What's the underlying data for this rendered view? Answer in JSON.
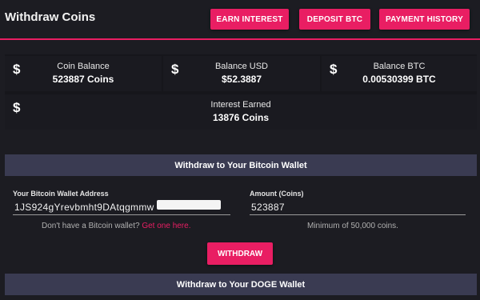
{
  "header": {
    "title": "Withdraw Coins",
    "buttons": {
      "earn_interest": "EARN INTEREST",
      "deposit_btc": "DEPOSIT BTC",
      "payment_history": "PAYMENT HISTORY"
    }
  },
  "stats": [
    {
      "icon": "dollar-icon",
      "symbol": "$",
      "label": "Coin Balance",
      "value": "523887 Coins"
    },
    {
      "icon": "dollar-icon",
      "symbol": "$",
      "label": "Balance USD",
      "value": "$52.3887"
    },
    {
      "icon": "dollar-icon",
      "symbol": "$",
      "label": "Balance BTC",
      "value": "0.00530399 BTC"
    },
    {
      "icon": "dollar-icon",
      "symbol": "$",
      "label": "Interest Earned",
      "value": "13876 Coins"
    }
  ],
  "bitcoin_section": {
    "title": "Withdraw to Your Bitcoin Wallet",
    "address_label": "Your Bitcoin Wallet Address",
    "address_value": "1JS924gYrevbmht9DAtqgmmw",
    "address_help": "Don't have a Bitcoin wallet?",
    "address_help_link": "Get one here.",
    "amount_label": "Amount (Coins)",
    "amount_value": "523887",
    "amount_help": "Minimum of 50,000 coins.",
    "withdraw_label": "WITHDRAW"
  },
  "doge_section": {
    "title": "Withdraw to Your DOGE Wallet"
  },
  "colors": {
    "accent": "#e91e63",
    "background": "#1c1c22",
    "section_bar": "#3a3b52"
  }
}
